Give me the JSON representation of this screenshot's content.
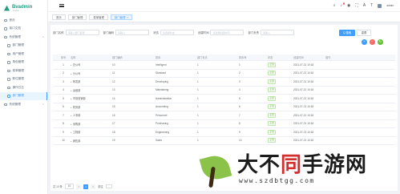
{
  "app": {
    "logo_title": "Bvadmin",
    "logo_sub": "system",
    "accent": "#409eff",
    "brand": "#1e9f83"
  },
  "sidebar": {
    "items": [
      {
        "label": "首页",
        "icon": "home-icon",
        "sub": false,
        "active": false
      },
      {
        "label": "接口文档",
        "icon": "doc-icon",
        "sub": false,
        "active": false
      },
      {
        "label": "系统管理",
        "icon": "settings-icon",
        "sub": false,
        "active": false,
        "chevron": "∧"
      },
      {
        "label": "部门管理",
        "icon": "tree-icon",
        "sub": true,
        "active": false
      },
      {
        "label": "用户管理",
        "icon": "user-icon",
        "sub": true,
        "active": false
      },
      {
        "label": "角色管理",
        "icon": "role-icon",
        "sub": true,
        "active": false
      },
      {
        "label": "菜单管理",
        "icon": "menu-icon",
        "sub": true,
        "active": false
      },
      {
        "label": "职位管理",
        "icon": "position-icon",
        "sub": true,
        "active": false
      },
      {
        "label": "操作日志",
        "icon": "log-icon",
        "sub": true,
        "active": false
      },
      {
        "label": "部门管理",
        "icon": "dept-icon",
        "sub": true,
        "active": true
      },
      {
        "label": "系统管理",
        "icon": "system-icon",
        "sub": false,
        "active": false,
        "chevron": "∨"
      }
    ]
  },
  "header": {
    "username": "admin"
  },
  "tabs": [
    {
      "label": "首页",
      "active": false
    },
    {
      "label": "部门管理",
      "active": false
    },
    {
      "label": "菜单管理",
      "active": false
    },
    {
      "label": "部门管理",
      "active": true,
      "close": "×"
    }
  ],
  "search": {
    "fields": [
      {
        "label": "部门名称",
        "placeholder": "请输入部门名称"
      },
      {
        "label": "部门编码",
        "placeholder": "请输入"
      },
      {
        "label": "状态",
        "placeholder": "请选择状态"
      },
      {
        "label": "创建时间",
        "placeholder": "请选择创建时间"
      },
      {
        "label": "部门负责",
        "placeholder": "请输入"
      }
    ],
    "search_label": "Q 搜索",
    "reset_label": "重置"
  },
  "actions": {
    "add": "+",
    "delete": "−",
    "refresh": "↻"
  },
  "table": {
    "headers": [
      "序号",
      "名称",
      "部门编码",
      "排序",
      "部门负责",
      "排序号",
      "状态",
      "创建时间",
      "操作"
    ],
    "rows": [
      {
        "idx": "1",
        "name": "总公司",
        "id": "10",
        "code": "Intelligent",
        "sort": "1",
        "seq": "1",
        "status": "正常",
        "time": "2021-07-21 10:18"
      },
      {
        "idx": "2",
        "name": "分公司",
        "id": "11",
        "code": "Standard",
        "sort": "1",
        "seq": "2",
        "status": "正常",
        "time": "2021-07-21 10:18"
      },
      {
        "idx": "3",
        "name": "研发部",
        "id": "12",
        "code": "Developing",
        "sort": "1",
        "seq": "3",
        "status": "正常",
        "time": "2021-07-21 10:18"
      },
      {
        "idx": "4",
        "name": "运维部",
        "id": "13",
        "code": "Maintaining",
        "sort": "1",
        "seq": "4",
        "status": "正常",
        "time": "2021-07-21 10:18"
      },
      {
        "idx": "5",
        "name": "市场营销部",
        "id": "14",
        "code": "Administration",
        "sort": "1",
        "seq": "5",
        "status": "正常",
        "time": "2021-07-21 10:18"
      },
      {
        "idx": "6",
        "name": "财务部",
        "id": "15",
        "code": "Accounting",
        "sort": "1",
        "seq": "6",
        "status": "正常",
        "time": "2021-07-21 10:18"
      },
      {
        "idx": "7",
        "name": "人事部",
        "id": "16",
        "code": "Personnel",
        "sort": "1",
        "seq": "7",
        "status": "正常",
        "time": "2021-07-21 10:18"
      },
      {
        "idx": "8",
        "name": "采购部",
        "id": "17",
        "code": "Purchasing",
        "sort": "1",
        "seq": "8",
        "status": "正常",
        "time": "2021-07-21 10:18"
      },
      {
        "idx": "9",
        "name": "工程部",
        "id": "18",
        "code": "Engineering",
        "sort": "1",
        "seq": "9",
        "status": "正常",
        "time": "2021-07-21 10:18"
      },
      {
        "idx": "10",
        "name": "销售部",
        "id": "19",
        "code": "Sales",
        "sort": "1",
        "seq": "10",
        "status": "正常",
        "time": "2021-07-21 10:18"
      }
    ]
  },
  "pager": {
    "total": "共 10 条",
    "size": "10",
    "prev": "<",
    "pages": [
      "1"
    ],
    "next": ">",
    "goto": "前往"
  },
  "watermark": {
    "title_a": "大不",
    "title_b": "同",
    "title_c": "手游网",
    "url": "www.szdbtgg.com"
  }
}
